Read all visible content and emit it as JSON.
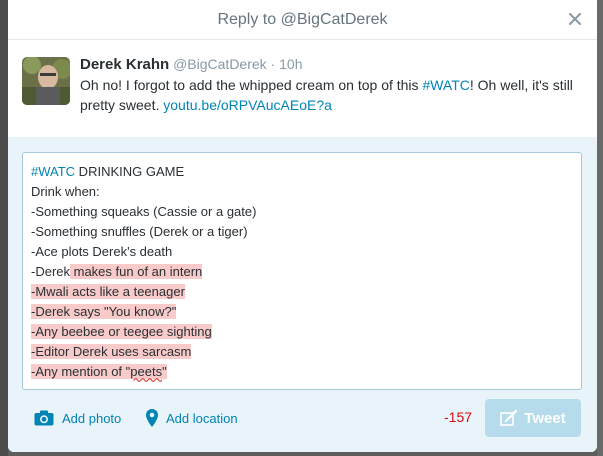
{
  "modal": {
    "title": "Reply to @BigCatDerek"
  },
  "original_tweet": {
    "fullname": "Derek Krahn",
    "username": "@BigCatDerek",
    "separator": " · ",
    "time": "10h",
    "text_before_hashtag": "Oh no! I forgot to add the whipped cream on top of this ",
    "hashtag": "#WATC",
    "text_after_hashtag": "! Oh well, it's still pretty sweet. ",
    "link": "youtu.be/oRPVAucAEoE?a"
  },
  "composer": {
    "lines": [
      {
        "hashtag": "#WATC",
        "rest": " DRINKING GAME"
      },
      {
        "plain": "Drink when:"
      },
      {
        "plain": "-Something squeaks (Cassie or a gate)"
      },
      {
        "plain": "-Something snuffles (Derek or a tiger)"
      },
      {
        "plain": "-Ace plots Derek's death"
      },
      {
        "plain": "-Derek",
        "over": " makes fun of an intern"
      },
      {
        "over": "-Mwali acts like a teenager"
      },
      {
        "over": "-Derek says \"You know?\""
      },
      {
        "over": "-Any beebee or teegee sighting"
      },
      {
        "over": "-Editor Derek uses sarcasm"
      },
      {
        "over": "-Any mention of \"",
        "misspelled": "peets",
        "over_end": "\""
      }
    ]
  },
  "toolbar": {
    "add_photo": "Add photo",
    "add_location": "Add location",
    "char_count": "-157",
    "tweet_label": "Tweet"
  },
  "colors": {
    "link": "#0084b4",
    "over_limit": "#d40d12",
    "tweet_button_disabled": "#b6dcec"
  }
}
